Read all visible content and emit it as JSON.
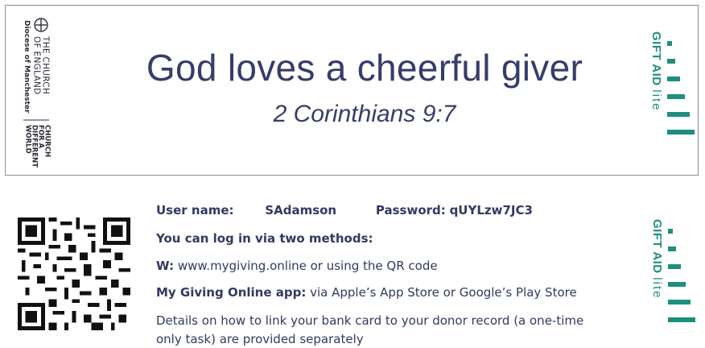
{
  "header_card": {
    "diocese": {
      "line1": "THE CHURCH",
      "line2": "OF ENGLAND",
      "line3": "Diocese of Manchester",
      "tagline1": "CHURCH",
      "tagline2": "FOR A",
      "tagline3": "DIFFERENT",
      "tagline4": "WORLD"
    },
    "headline": "God loves a cheerful giver",
    "verse": "2 Corinthians 9:7",
    "giftaid": {
      "brand": "GIFT AID",
      "suffix": "lite"
    }
  },
  "details": {
    "username_label": "User name:",
    "username_value": "SAdamson",
    "password_label": "Password:",
    "password_value": "qUYLzw7JC3",
    "login_heading": "You can log in via two methods:",
    "web_label": "W:",
    "web_text": "www.mygiving.online or using the QR code",
    "app_label": "My Giving Online app:",
    "app_text": "via Apple’s App Store or Google’s Play Store",
    "details_line1": "Details on how to link your bank card to your donor record (a one-time",
    "details_line2": "only task) are provided separately",
    "giftaid": {
      "brand": "GIFT AID",
      "suffix": "lite"
    }
  },
  "colors": {
    "navy": "#353d69",
    "teal": "#1e8e7e",
    "border": "#8a8d99"
  }
}
